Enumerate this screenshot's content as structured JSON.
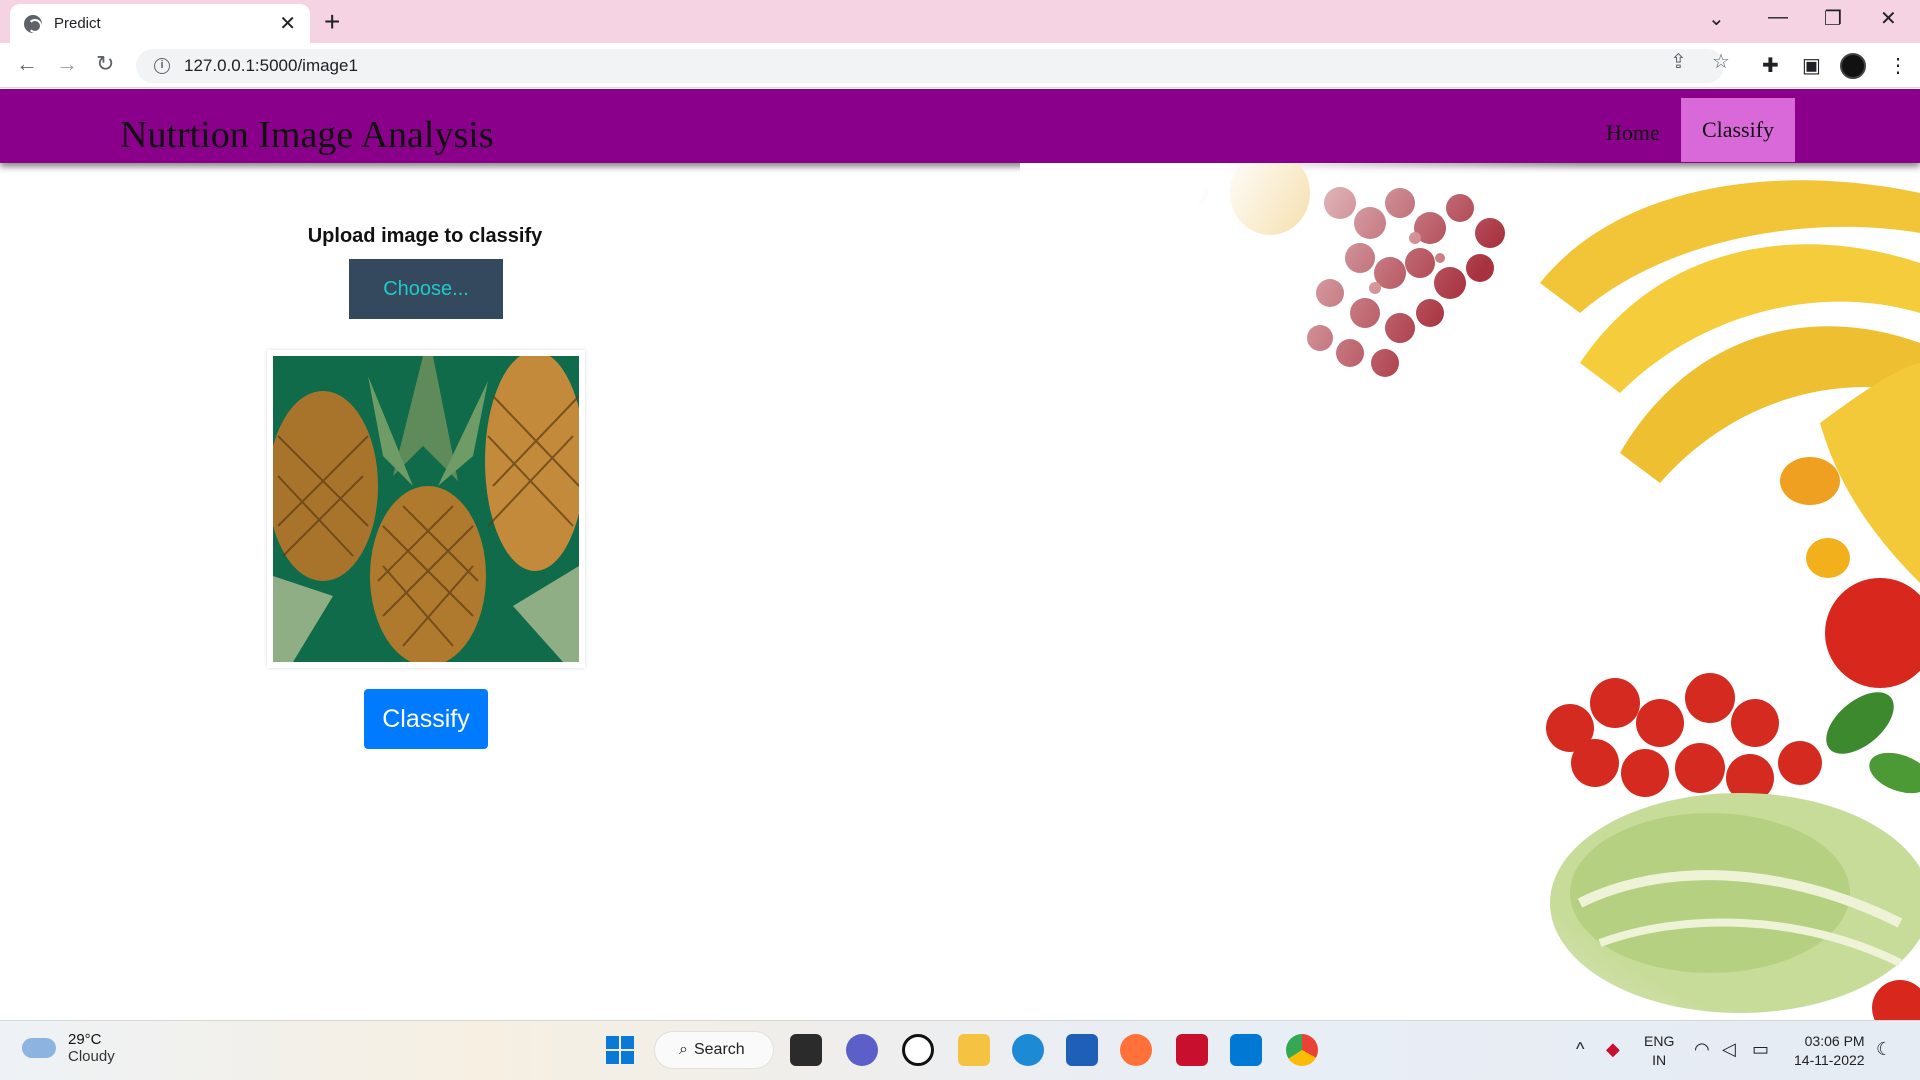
{
  "browser": {
    "tab_title": "Predict",
    "tab_close": "✕",
    "new_tab": "+",
    "url": "127.0.0.1:5000/image1"
  },
  "navbar": {
    "brand": "Nutrtion Image Analysis",
    "home_label": "Home",
    "classify_label": "Classify",
    "color": "#8b008b",
    "active_color": "#d968d9"
  },
  "main": {
    "upload_label": "Upload image to classify",
    "choose_label": "Choose...",
    "classify_button": "Classify",
    "preview_image": "pineapple-photo"
  },
  "taskbar": {
    "temperature": "29°C",
    "condition": "Cloudy",
    "search_label": "Search",
    "lang_line1": "ENG",
    "lang_line2": "IN",
    "time": "03:06 PM",
    "date": "14-11-2022"
  }
}
